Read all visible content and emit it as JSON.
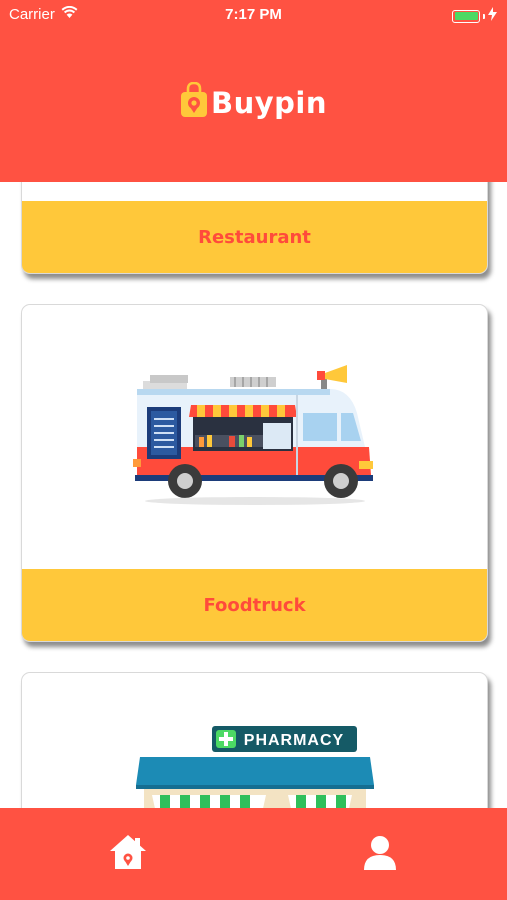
{
  "status_bar": {
    "carrier": "Carrier",
    "time": "7:17 PM",
    "battery_level": 1.0
  },
  "app": {
    "name": "Buypin",
    "brand_color": "#ff5242",
    "accent_color": "#ffc83a"
  },
  "categories": [
    {
      "label": "Restaurant",
      "icon": "restaurant-image"
    },
    {
      "label": "Foodtruck",
      "icon": "foodtruck-image"
    },
    {
      "label": "",
      "icon": "pharmacy-image",
      "sign_text": "PHARMACY"
    }
  ],
  "tabbar": {
    "items": [
      {
        "icon": "home-icon"
      },
      {
        "icon": "profile-icon"
      }
    ]
  }
}
